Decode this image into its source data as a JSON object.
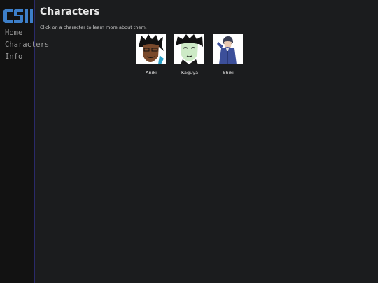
{
  "nav": {
    "logo_text": "CSII",
    "items": [
      {
        "label": "Home"
      },
      {
        "label": "Characters"
      },
      {
        "label": "Info"
      }
    ]
  },
  "main": {
    "title": "Characters",
    "subtitle": "Click on a character to learn more about them."
  },
  "characters": [
    {
      "name": "Aniki",
      "portrait": "aniki-portrait"
    },
    {
      "name": "Kaguya",
      "portrait": "kaguya-portrait"
    },
    {
      "name": "Shiki",
      "portrait": "shiki-portrait"
    }
  ],
  "colors": {
    "background": "#1b1c1e",
    "sidebar": "#121212",
    "sidebar_border": "#2a2a6a",
    "logo": "#3d7fc9"
  }
}
